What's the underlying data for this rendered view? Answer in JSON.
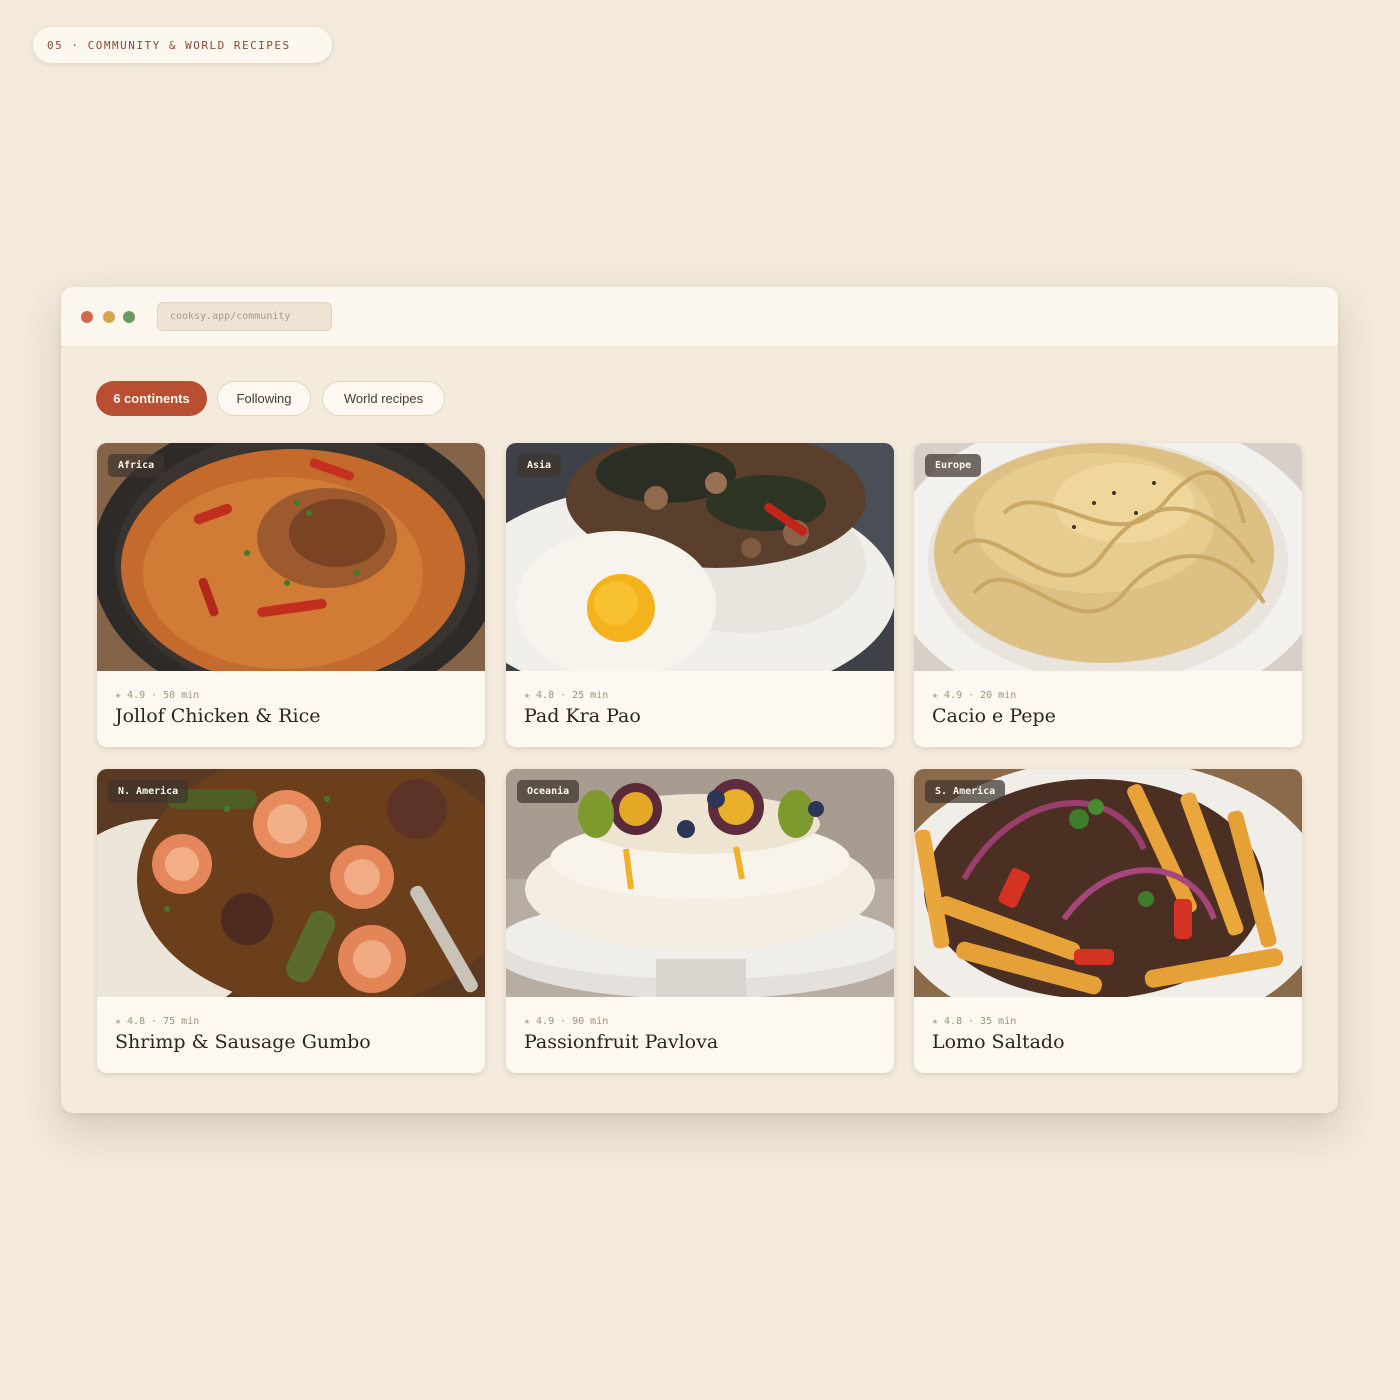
{
  "section_tag": "05 · COMMUNITY & WORLD RECIPES",
  "window": {
    "url": "cooksy.app/community"
  },
  "filters": [
    {
      "label": "6 continents",
      "active": true
    },
    {
      "label": "Following",
      "active": false
    },
    {
      "label": "World recipes",
      "active": false
    }
  ],
  "recipes": [
    {
      "region": "Africa",
      "rating": "4.9",
      "time": "50 min",
      "title": "Jollof Chicken & Rice"
    },
    {
      "region": "Asia",
      "rating": "4.8",
      "time": "25 min",
      "title": "Pad Kra Pao"
    },
    {
      "region": "Europe",
      "rating": "4.9",
      "time": "20 min",
      "title": "Cacio e Pepe"
    },
    {
      "region": "N. America",
      "rating": "4.8",
      "time": "75 min",
      "title": "Shrimp & Sausage Gumbo"
    },
    {
      "region": "Oceania",
      "rating": "4.9",
      "time": "90 min",
      "title": "Passionfruit Pavlova"
    },
    {
      "region": "S. America",
      "rating": "4.8",
      "time": "35 min",
      "title": "Lomo Saltado"
    }
  ],
  "icons": {
    "rating": "star-icon",
    "separator": "·"
  },
  "colors": {
    "accent": "#b84e32",
    "background": "#f3eadc",
    "card": "#fdf8f0"
  }
}
